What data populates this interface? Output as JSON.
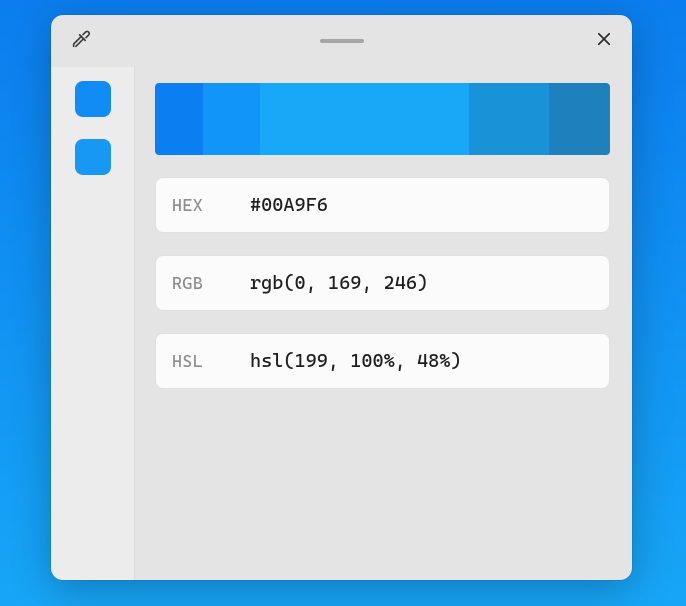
{
  "history": [
    {
      "color": "#108cf4"
    },
    {
      "color": "#1798f2"
    }
  ],
  "palette": [
    {
      "color": "#0b7ff1",
      "width": 10.5
    },
    {
      "color": "#1295f8",
      "width": 12.5
    },
    {
      "color": "#19a8f8",
      "width": 46
    },
    {
      "color": "#1a92d8",
      "width": 17.5
    },
    {
      "color": "#1e81bd",
      "width": 13.5
    }
  ],
  "cards": {
    "hex": {
      "label": "HEX",
      "value": "#00A9F6"
    },
    "rgb": {
      "label": "RGB",
      "value": "rgb(0, 169, 246)"
    },
    "hsl": {
      "label": "HSL",
      "value": "hsl(199, 100%, 48%)"
    }
  }
}
